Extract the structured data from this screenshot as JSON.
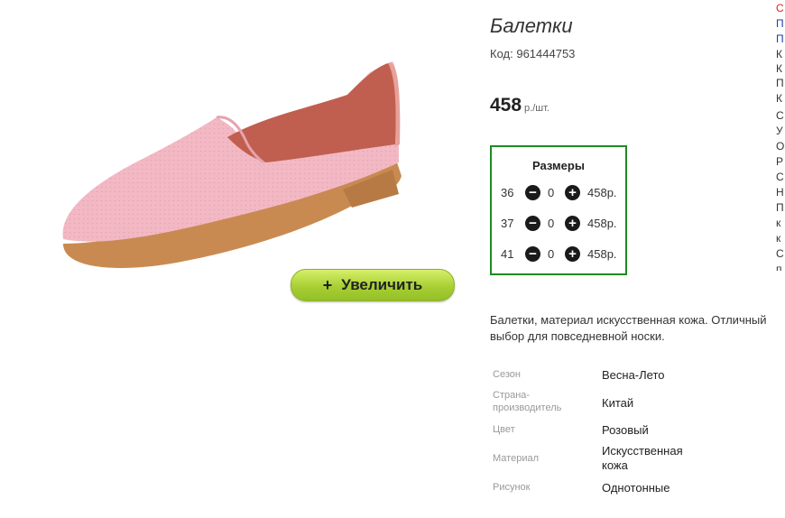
{
  "product": {
    "title": "Балетки",
    "code_label": "Код:",
    "code": "961444753",
    "price": "458",
    "price_unit": "р./шт.",
    "description": "Балетки, материал искусственная кожа. Отличный выбор для повседневной носки."
  },
  "zoom_button": {
    "plus": "+",
    "label": "Увеличить"
  },
  "sizes": {
    "title": "Размеры",
    "rows": [
      {
        "size": "36",
        "qty": "0",
        "price": "458р."
      },
      {
        "size": "37",
        "qty": "0",
        "price": "458р."
      },
      {
        "size": "41",
        "qty": "0",
        "price": "458р."
      }
    ],
    "border_color": "#1f8a1f"
  },
  "specs": [
    {
      "label": "Сезон",
      "value": "Весна-Лето"
    },
    {
      "label": "Страна-производитель",
      "value": "Китай"
    },
    {
      "label": "Цвет",
      "value": "Розовый"
    },
    {
      "label": "Материал",
      "value": "Искусственная кожа"
    },
    {
      "label": "Рисунок",
      "value": "Однотонные"
    }
  ],
  "right_column_letters": [
    "С",
    "П",
    "П",
    "К",
    "К",
    "П",
    "К",
    "С",
    "У",
    "О",
    "Р",
    "С",
    "Н",
    "П",
    "к",
    "к",
    "С",
    "п"
  ],
  "colors": {
    "accent_green": "#a8cf34",
    "sizes_border": "#1f8a1f",
    "shoe": "#f2b9c4"
  }
}
